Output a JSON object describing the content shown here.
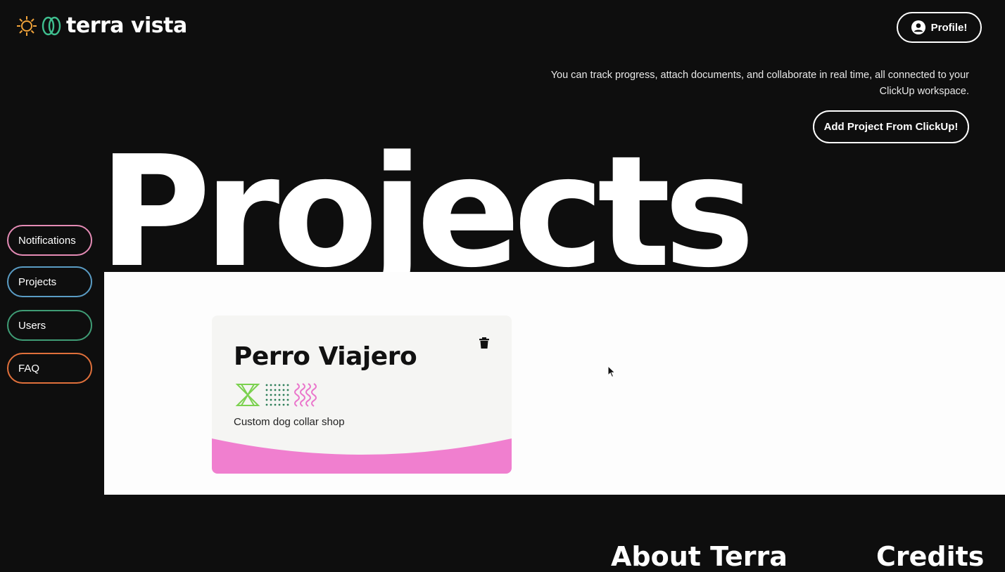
{
  "brand": {
    "name": "terra vista"
  },
  "header": {
    "profile_label": "Profile!"
  },
  "intro": {
    "text": "You can track progress, attach documents, and collaborate in real time, all connected to your ClickUp workspace.",
    "add_button_label": "Add Project From ClickUp!"
  },
  "hero": {
    "title": "Projects"
  },
  "sidebar": {
    "items": [
      {
        "label": "Notifications",
        "color": "#e48bb5"
      },
      {
        "label": "Projects",
        "color": "#5a9cc4"
      },
      {
        "label": "Users",
        "color": "#3f9c75"
      },
      {
        "label": "FAQ",
        "color": "#e0703b"
      }
    ]
  },
  "project_card": {
    "title": "Perro Viajero",
    "description": "Custom dog collar shop",
    "accent_color": "#f07fcf",
    "icons": [
      "hourglass-pattern-icon",
      "dot-grid-icon",
      "wave-lines-icon"
    ]
  },
  "footer": {
    "about_heading": "About Terra",
    "credits_heading": "Credits"
  }
}
